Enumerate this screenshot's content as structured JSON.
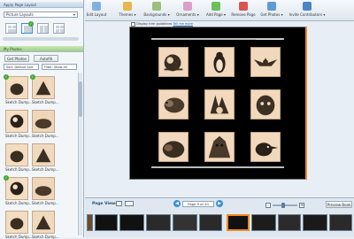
{
  "left_panel": {
    "apply_layout_header": "Apply Page Layout",
    "layout_select": "Picture Layouts",
    "my_photos_header": "My Photos",
    "get_photos_label": "Get Photos",
    "autofill_label": "Autofill",
    "sort_select": "Sort: Default Sort",
    "filter_select": "Filter: Show All",
    "thumbnails": [
      {
        "label": "Sketch Dump...",
        "checked": true
      },
      {
        "label": "Sketch Dump...",
        "checked": true
      },
      {
        "label": "Sketch Dump...",
        "checked": false
      },
      {
        "label": "Sketch Dump...",
        "checked": false
      },
      {
        "label": "Sketch Dump...",
        "checked": false
      },
      {
        "label": "Sketch Dump...",
        "checked": false
      },
      {
        "label": "Sketch Dump...",
        "checked": true
      },
      {
        "label": "Sketch Dump...",
        "checked": false
      },
      {
        "label": "Sketch Dump...",
        "checked": false
      },
      {
        "label": "Sketch Dump...",
        "checked": false
      }
    ]
  },
  "toolbar": {
    "items": [
      {
        "label": "Edit Layout"
      },
      {
        "label": "Themes ▾"
      },
      {
        "label": "Backgrounds ▾"
      },
      {
        "label": "Ornaments ▾"
      },
      {
        "label": "Add Page ▾"
      },
      {
        "label": "Remove Page"
      },
      {
        "label": "Get Photos ▾"
      },
      {
        "label": "Invite Contributors ▾"
      }
    ]
  },
  "canvas": {
    "guides_text": "Display trim guidelines",
    "guides_link": "Tell me more"
  },
  "page_views": {
    "title": "Page Views",
    "page_indicator": "Page 9 of 20",
    "preview_label": "Preview Book"
  },
  "colors": {
    "accent": "#3a8ed8",
    "check_green": "#3faa2e",
    "selected_orange": "#f08a1c"
  }
}
